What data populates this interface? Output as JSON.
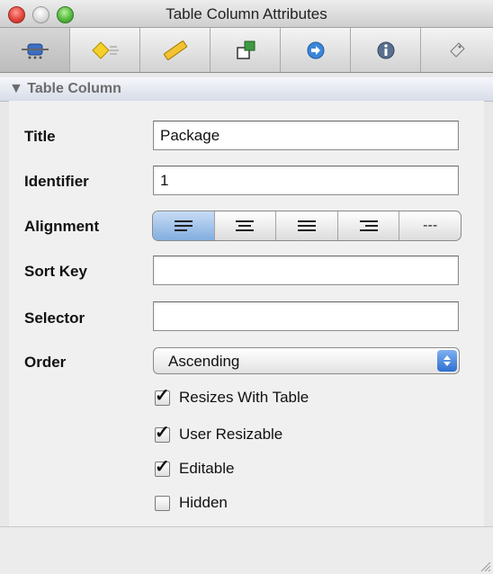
{
  "window": {
    "title": "Table Column Attributes"
  },
  "toolbar": {
    "tabs": [
      {
        "icon": "attributes-icon",
        "active": true
      },
      {
        "icon": "effects-diamond-icon",
        "active": false
      },
      {
        "icon": "ruler-icon",
        "active": false
      },
      {
        "icon": "connections-icon",
        "active": false
      },
      {
        "icon": "bindings-arrow-icon",
        "active": false
      },
      {
        "icon": "info-icon",
        "active": false
      },
      {
        "icon": "identity-icon",
        "active": false
      }
    ]
  },
  "section": {
    "title": "▼ Table Column"
  },
  "form": {
    "title": {
      "label": "Title",
      "value": "Package"
    },
    "identifier": {
      "label": "Identifier",
      "value": "1"
    },
    "alignment": {
      "label": "Alignment",
      "options": [
        "left",
        "center",
        "justified",
        "right",
        "---"
      ],
      "selected": "left"
    },
    "sort_key": {
      "label": "Sort Key",
      "value": ""
    },
    "selector": {
      "label": "Selector",
      "value": ""
    },
    "order": {
      "label": "Order",
      "value": "Ascending"
    }
  },
  "options": {
    "resizes_with_table": {
      "label": "Resizes With Table",
      "checked": true
    },
    "user_resizable": {
      "label": "User Resizable",
      "checked": true
    },
    "editable": {
      "label": "Editable",
      "checked": true
    },
    "hidden": {
      "label": "Hidden",
      "checked": false
    }
  },
  "colors": {
    "selected_segment": "#82aee0",
    "popup_arrows": "#2e6fd1",
    "close_button": "#e0443a"
  }
}
